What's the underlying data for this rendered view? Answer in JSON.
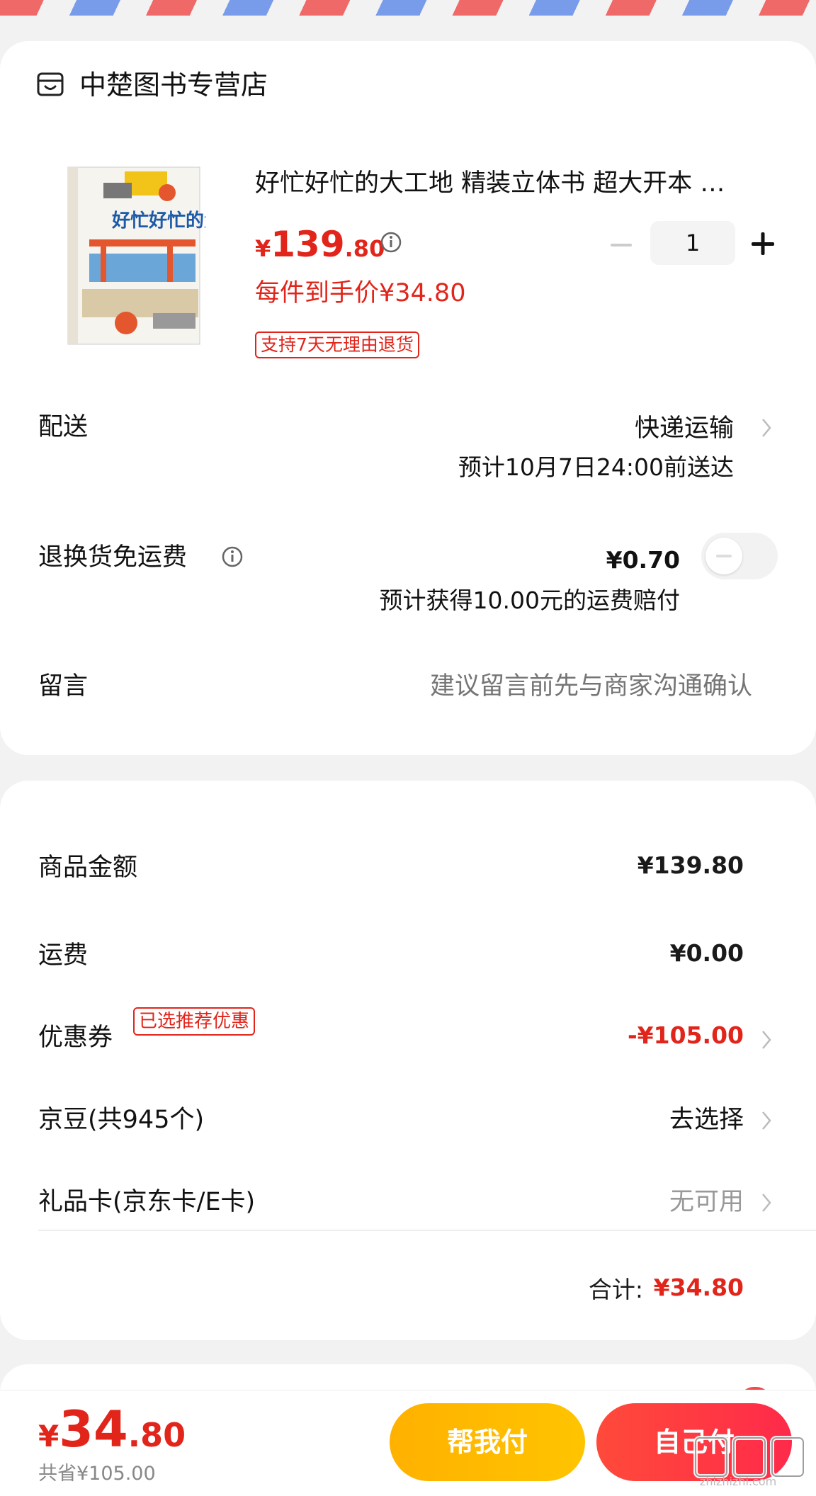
{
  "store": {
    "name": "中楚图书专营店",
    "icon": "store-icon"
  },
  "product": {
    "title": "好忙好忙的大工地 精装立体书 超大开本 …",
    "cover_text": "好忙好忙的大工地",
    "price_symbol": "¥",
    "price_int": "139",
    "price_dec": ".80",
    "quantity": "1",
    "per_item_price": "每件到手价¥34.80",
    "return_tag": "支持7天无理由退货"
  },
  "delivery": {
    "label": "配送",
    "method": "快递运输",
    "eta": "预计10月7日24:00前送达"
  },
  "return_shipping": {
    "label": "退换货免运费",
    "price": "¥0.70",
    "note": "预计获得10.00元的运费赔付",
    "enabled": false
  },
  "note": {
    "label": "留言",
    "placeholder": "建议留言前先与商家沟通确认"
  },
  "summary": {
    "goods_label": "商品金额",
    "goods_value": "¥139.80",
    "shipping_label": "运费",
    "shipping_value": "¥0.00",
    "coupon_label": "优惠券",
    "coupon_tag": "已选推荐优惠",
    "coupon_value": "-¥105.00",
    "beans_label": "京豆(共945个)",
    "beans_value": "去选择",
    "giftcard_label": "礼品卡(京东卡/E卡)",
    "giftcard_value": "无可用",
    "total_label": "合计:",
    "total_value": "¥34.80"
  },
  "bottom": {
    "price_symbol": "¥",
    "price_int": "34",
    "price_dec": ".80",
    "saved": "共省¥105.00",
    "help_pay": "帮我付",
    "self_pay": "自己付",
    "watermark": "zhizhizhi.com"
  },
  "colors": {
    "accent": "#e1251b",
    "help_button": "#ffb800",
    "self_button": "#ff3a3a"
  }
}
